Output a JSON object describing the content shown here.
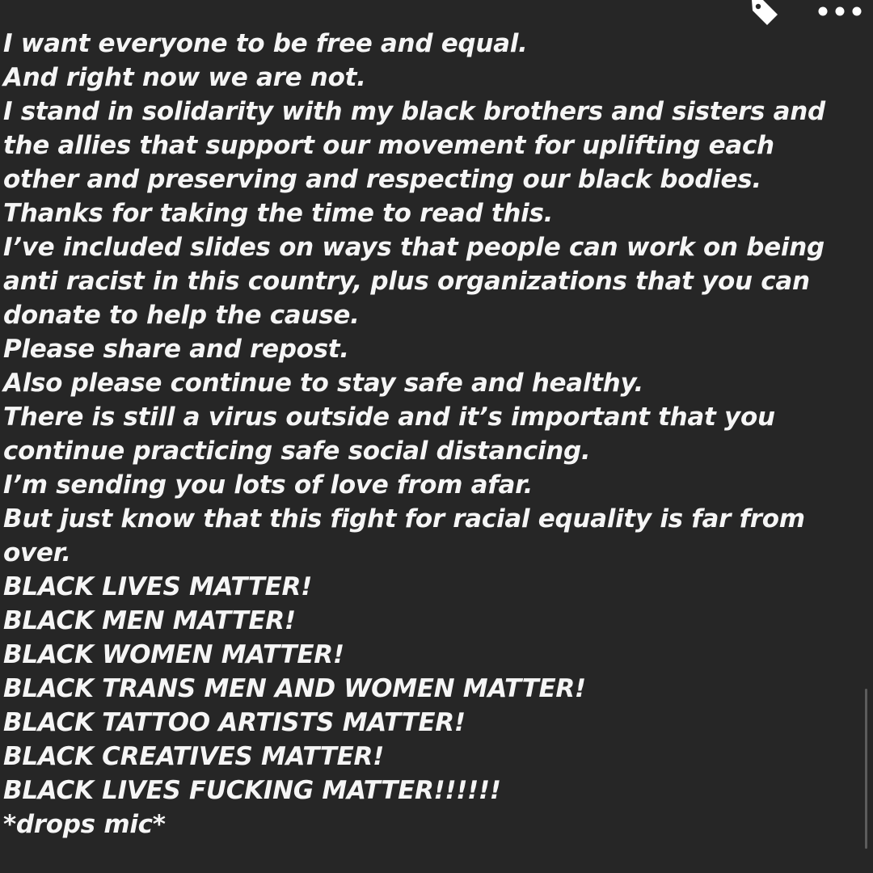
{
  "post": {
    "lines": [
      "I want everyone to be free and equal.",
      "And right now we are not.",
      "I stand in solidarity with my black brothers and sisters and",
      "the allies that support our movement for uplifting each",
      "other and preserving and respecting our black bodies.",
      "Thanks for taking the time to read this.",
      "I’ve included slides on ways that people can work on being",
      "anti racist in this country, plus organizations that you can",
      "donate to help the cause.",
      "Please share and repost.",
      "Also please continue to stay safe and healthy.",
      "There is still a virus outside and it’s important that you",
      "continue practicing safe social distancing.",
      "I’m sending you lots of love from afar.",
      "But just know that this fight for racial equality is far from",
      "over.",
      "BLACK LIVES MATTER!",
      "BLACK MEN MATTER!",
      "BLACK WOMEN MATTER!",
      "BLACK TRANS MEN AND WOMEN MATTER!",
      "BLACK TATTOO ARTISTS MATTER!",
      "BLACK CREATIVES MATTER!",
      "BLACK LIVES FUCKING MATTER!!!!!!",
      "*drops mic*"
    ]
  },
  "icons": {
    "tag": "tag-icon",
    "more": "more-options-icon"
  },
  "colors": {
    "background": "#262626",
    "text": "#f5f5f5",
    "icon": "#ffffff"
  }
}
